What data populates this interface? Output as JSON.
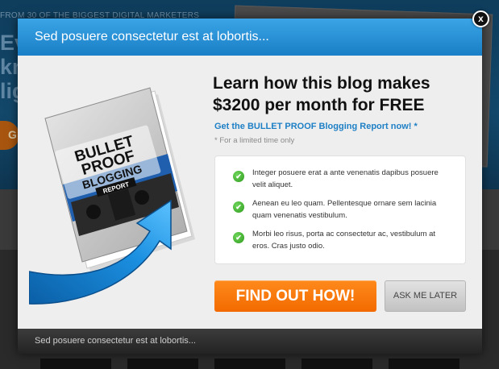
{
  "background": {
    "tagline": "FROM 30 OF THE BIGGEST DIGITAL MARKETERS",
    "headline_fragment": "Eve kno lig",
    "cta_fragment": "G"
  },
  "modal": {
    "header_title": "Sed posuere consectetur est at lobortis...",
    "close_label": "x",
    "headline": "Learn how this blog makes $3200 per month for FREE",
    "subhead": "Get the BULLET PROOF Blogging Report now!",
    "subhead_star": "*",
    "note": "* For a limited time only",
    "benefits": [
      "Integer posuere erat a ante venenatis dapibus posuere velit aliquet.",
      "Aenean eu leo quam. Pellentesque ornare sem lacinia quam venenatis vestibulum.",
      "Morbi leo risus, porta ac consectetur ac, vestibulum at eros. Cras justo odio."
    ],
    "cta_label": "FIND OUT HOW!",
    "later_label": "ASK ME LATER",
    "footer_text": "Sed posuere consectetur est at lobortis..."
  },
  "product": {
    "cover_line1": "BULLET",
    "cover_line2": "PROOF",
    "cover_line3": "BLOGGING",
    "cover_line4": "REPORT"
  },
  "colors": {
    "header_blue": "#1a7fc6",
    "accent_orange": "#f26a00",
    "check_green": "#2f9b1f",
    "link_blue": "#1d7fc5"
  },
  "icons": {
    "close": "close-icon",
    "check": "check-icon",
    "arrow": "arrow-icon"
  }
}
